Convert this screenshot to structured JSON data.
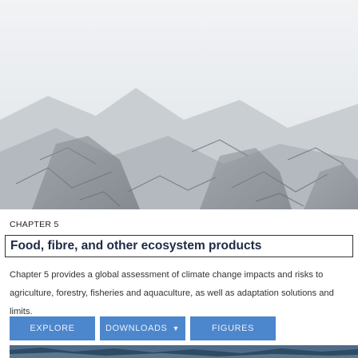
{
  "chapter": {
    "label": "CHAPTER 5",
    "title": "Food, fibre, and other ecosystem products",
    "description": "Chapter 5 provides a global assessment of climate change impacts and risks to agriculture, forestry, fisheries and aquaculture, as well as adaptation solutions and limits."
  },
  "actions": {
    "explore_label": "EXPLORE",
    "downloads_label": "DOWNLOADS",
    "figures_label": "FIGURES"
  },
  "colors": {
    "button_bg": "#4c86cc",
    "title_text": "#1e2a44"
  }
}
